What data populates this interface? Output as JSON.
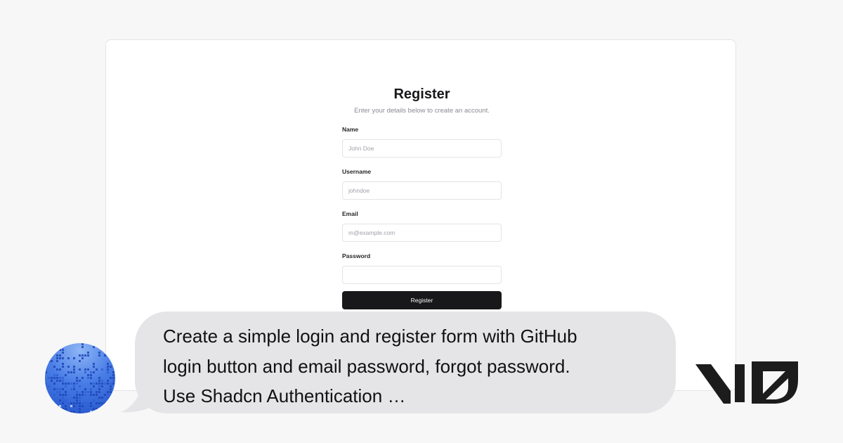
{
  "form": {
    "title": "Register",
    "subtitle": "Enter your details below to create an account.",
    "fields": [
      {
        "label": "Name",
        "placeholder": "John Doe",
        "value": ""
      },
      {
        "label": "Username",
        "placeholder": "johndoe",
        "value": ""
      },
      {
        "label": "Email",
        "placeholder": "m@example.com",
        "value": ""
      },
      {
        "label": "Password",
        "placeholder": "",
        "value": ""
      }
    ],
    "submit_label": "Register"
  },
  "prompt": {
    "text": "Create a simple login and register form with GitHub\nlogin button and email password, forgot password.\nUse Shadcn Authentication …"
  },
  "brand": {
    "logo": "v0-logo",
    "avatar_icon": "pixel-gradient-avatar"
  },
  "colors": {
    "page_background": "#f7f7f7",
    "card_background": "#ffffff",
    "button_background": "#18181b",
    "bubble_background": "#e5e5e7",
    "avatar_blue": "#2f5fd6",
    "logo_color": "#1c1c1c"
  }
}
